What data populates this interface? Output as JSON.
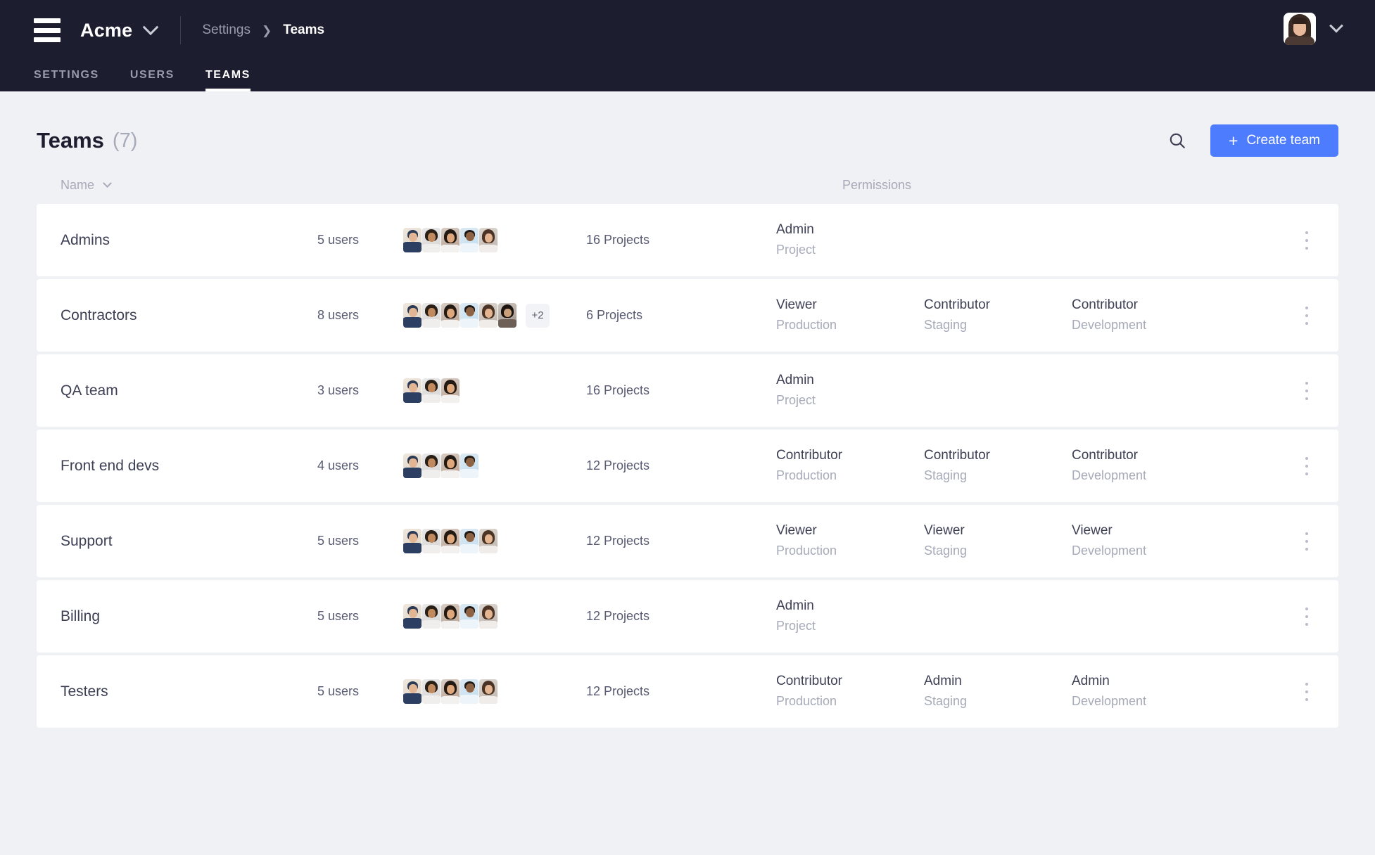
{
  "topbar": {
    "menu_icon": "hamburger-icon",
    "brand": "Acme",
    "brand_chevron": "chevron-down-icon",
    "breadcrumb": {
      "parent": "Settings",
      "separator": "❯",
      "current": "Teams"
    },
    "account_chevron": "chevron-down-icon"
  },
  "tabs": [
    {
      "label": "SETTINGS",
      "active": false
    },
    {
      "label": "USERS",
      "active": false
    },
    {
      "label": "TEAMS",
      "active": true
    }
  ],
  "page": {
    "title": "Teams",
    "count": "(7)",
    "search_icon": "search-icon",
    "create_button": {
      "plus": "+",
      "label": "Create team"
    },
    "accent_color": "#4d7cfe"
  },
  "columns": {
    "name": "Name",
    "name_sort_icon": "chevron-down-icon",
    "permissions": "Permissions"
  },
  "rows": [
    {
      "name": "Admins",
      "users": "5 users",
      "avatar_count": 5,
      "more": "",
      "projects": "16 Projects",
      "permissions": [
        {
          "role": "Admin",
          "env": "Project"
        }
      ],
      "menu_icon": "kebab-menu-icon"
    },
    {
      "name": "Contractors",
      "users": "8 users",
      "avatar_count": 6,
      "more": "+2",
      "projects": "6 Projects",
      "permissions": [
        {
          "role": "Viewer",
          "env": "Production"
        },
        {
          "role": "Contributor",
          "env": "Staging"
        },
        {
          "role": "Contributor",
          "env": "Development"
        }
      ],
      "menu_icon": "kebab-menu-icon"
    },
    {
      "name": "QA team",
      "users": "3 users",
      "avatar_count": 3,
      "more": "",
      "projects": "16 Projects",
      "permissions": [
        {
          "role": "Admin",
          "env": "Project"
        }
      ],
      "menu_icon": "kebab-menu-icon"
    },
    {
      "name": "Front end devs",
      "users": "4 users",
      "avatar_count": 4,
      "more": "",
      "projects": "12 Projects",
      "permissions": [
        {
          "role": "Contributor",
          "env": "Production"
        },
        {
          "role": "Contributor",
          "env": "Staging"
        },
        {
          "role": "Contributor",
          "env": "Development"
        }
      ],
      "menu_icon": "kebab-menu-icon"
    },
    {
      "name": "Support",
      "users": "5 users",
      "avatar_count": 5,
      "more": "",
      "projects": "12 Projects",
      "permissions": [
        {
          "role": "Viewer",
          "env": "Production"
        },
        {
          "role": "Viewer",
          "env": "Staging"
        },
        {
          "role": "Viewer",
          "env": "Development"
        }
      ],
      "menu_icon": "kebab-menu-icon"
    },
    {
      "name": "Billing",
      "users": "5 users",
      "avatar_count": 5,
      "more": "",
      "projects": "12 Projects",
      "permissions": [
        {
          "role": "Admin",
          "env": "Project"
        }
      ],
      "menu_icon": "kebab-menu-icon"
    },
    {
      "name": "Testers",
      "users": "5 users",
      "avatar_count": 5,
      "more": "",
      "projects": "12 Projects",
      "permissions": [
        {
          "role": "Contributor",
          "env": "Production"
        },
        {
          "role": "Admin",
          "env": "Staging"
        },
        {
          "role": "Admin",
          "env": "Development"
        }
      ],
      "menu_icon": "kebab-menu-icon"
    }
  ]
}
